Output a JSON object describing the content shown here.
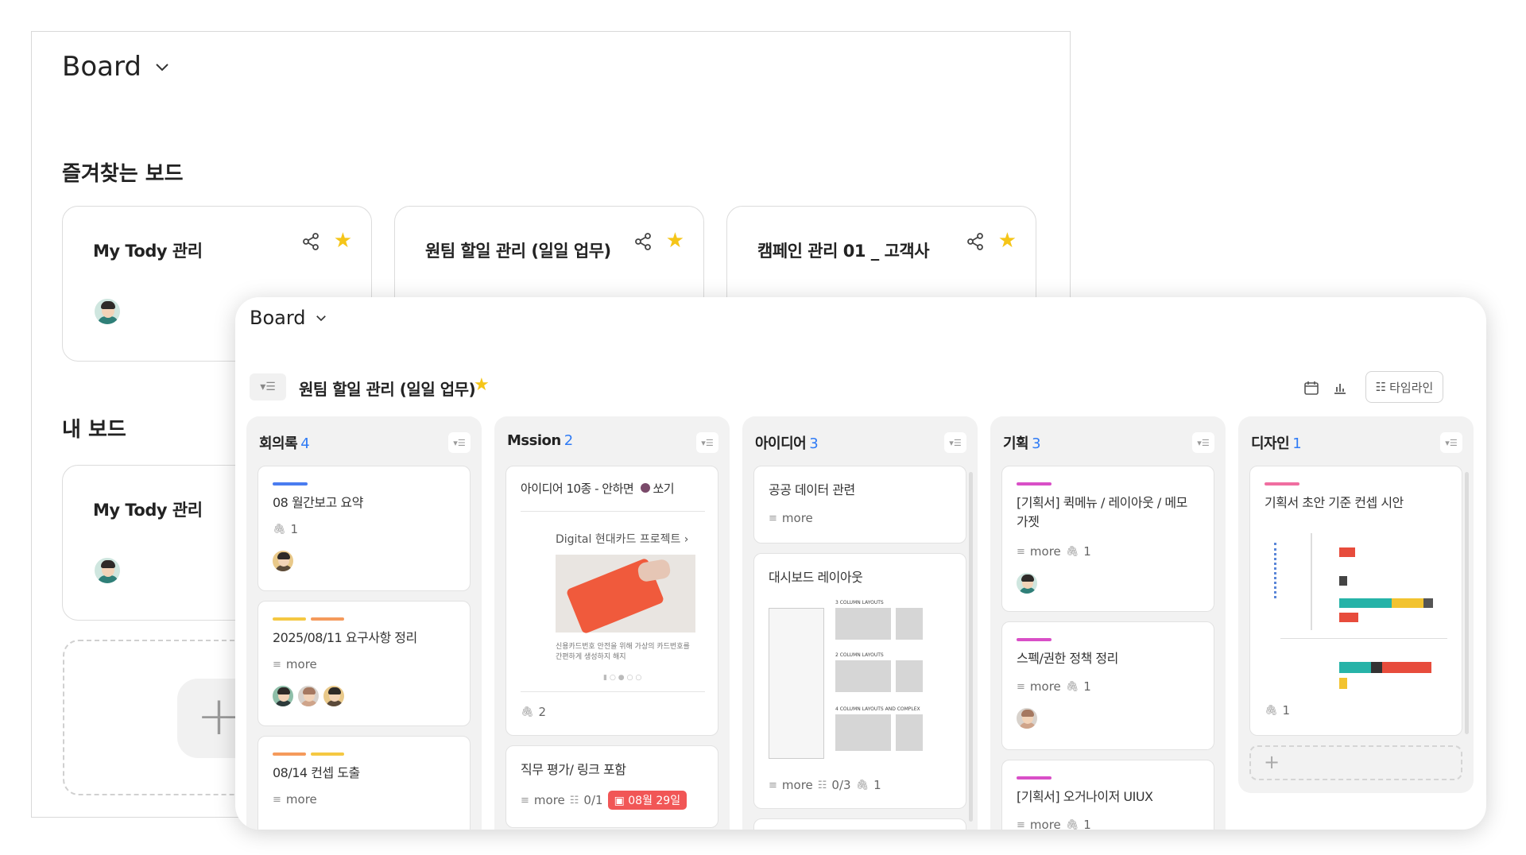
{
  "back": {
    "title": "Board",
    "favorites_title": "즐겨찾는 보드",
    "favorites": [
      {
        "name": "My Tody 관리"
      },
      {
        "name": "원팀 할일 관리 (일일 업무)"
      },
      {
        "name": "캠페인 관리 01 _ 고객사"
      }
    ],
    "my_title": "내 보드",
    "my_boards": [
      {
        "name": "My Tody 관리"
      }
    ]
  },
  "front": {
    "title": "Board",
    "project": "원팀 할일 관리 (일일 업무)",
    "timeline_label": "타임라인",
    "columns": [
      {
        "name": "회의록",
        "count": "4",
        "cards": [
          {
            "title": "08 월간보고 요약",
            "attach": "1",
            "bar_colors": [
              "#4a7cf0"
            ]
          },
          {
            "title": "2025/08/11 요구사항 정리",
            "more": "more",
            "bar_colors": [
              "#f5c842",
              "#f59a5b"
            ]
          },
          {
            "title": "08/14 컨셉 도출",
            "more": "more",
            "bar_colors": [
              "#f59a5b",
              "#f5c842"
            ]
          }
        ]
      },
      {
        "name": "Mssion",
        "count": "2",
        "cards": [
          {
            "title": "아이디어 10종 - 안하면",
            "title_suffix": "쏘기",
            "attach": "2",
            "thumb_heading": "Digital 현대카드 프로젝트 ›",
            "thumb_caption": "신용카드번호 안전을 위해 가상의 카드번호를 간편하게 생성하지 해지"
          },
          {
            "title": "직무 평가/ 링크 포함",
            "more": "more",
            "checklist": "0/1",
            "due": "08월 29일"
          }
        ]
      },
      {
        "name": "아이디어",
        "count": "3",
        "cards": [
          {
            "title": "공공 데이터 관련",
            "more": "more"
          },
          {
            "title": "대시보드 레이아웃",
            "more": "more",
            "checklist": "0/3",
            "attach": "1",
            "thumb_labels": [
              "3 COLUMN LAYOUTS",
              "2 COLUMN LAYOUTS",
              "4 COLUMN LAYOUTS AND COMPLEX"
            ]
          }
        ]
      },
      {
        "name": "기획",
        "count": "3",
        "cards": [
          {
            "title": "[기획서] 퀵메뉴 / 레이아웃 / 메모 가젯",
            "more": "more",
            "attach": "1",
            "bar_colors": [
              "#d94fc7"
            ]
          },
          {
            "title": "스펙/권한 정책 정리",
            "more": "more",
            "attach": "1",
            "bar_colors": [
              "#d94fc7"
            ]
          },
          {
            "title": "[기획서] 오거나이저 UIUX",
            "more": "more",
            "attach": "1",
            "bar_colors": [
              "#d94fc7"
            ]
          }
        ]
      },
      {
        "name": "디자인",
        "count": "1",
        "cards": [
          {
            "title": "기획서 초안 기준 컨셉 시안",
            "attach": "1",
            "bar_colors": [
              "#f06ea0"
            ]
          }
        ]
      }
    ]
  },
  "colors": {
    "accent": "#2f7bf5",
    "star": "#f5c518",
    "due": "#f15656"
  }
}
